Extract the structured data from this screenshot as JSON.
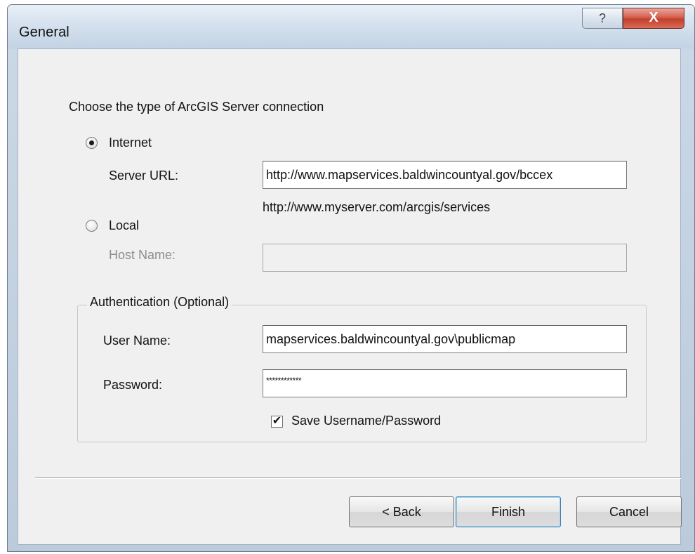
{
  "window": {
    "title": "General",
    "help_glyph": "?",
    "close_glyph": "X"
  },
  "connection": {
    "heading": "Choose the type of ArcGIS Server connection",
    "internet_label": "Internet",
    "internet_selected": true,
    "server_url_label": "Server URL:",
    "server_url_value": "http://www.mapservices.baldwincountyal.gov/bccex",
    "server_url_hint": "http://www.myserver.com/arcgis/services",
    "local_label": "Local",
    "local_selected": false,
    "host_name_label": "Host Name:",
    "host_name_value": ""
  },
  "authentication": {
    "group_title": "Authentication (Optional)",
    "username_label": "User Name:",
    "username_value": "mapservices.baldwincountyal.gov\\publicmap",
    "password_label": "Password:",
    "password_value": "************",
    "save_label": "Save Username/Password",
    "save_checked": true,
    "check_glyph": "✔"
  },
  "buttons": {
    "back": "< Back",
    "finish": "Finish",
    "cancel": "Cancel"
  }
}
